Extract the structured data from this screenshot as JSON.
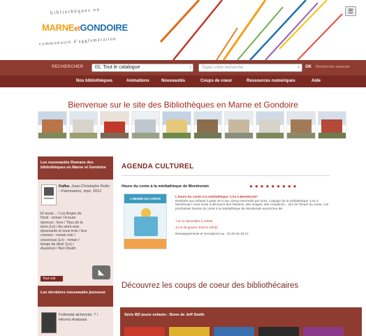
{
  "header": {
    "logo_line1": "bibliothèques en",
    "logo_marne": "MARNE",
    "logo_et": "et",
    "logo_gondoire": "GONDOIRE",
    "logo_line3": "communauté d'agglomération",
    "access_icon": "accessibility-icon"
  },
  "search": {
    "label": "RECHERCHER",
    "catalog_value": "01. Tout le catalogue",
    "input_placeholder": "Tapez votre recherche",
    "ok_label": "OK",
    "advanced_label": "Recherche avancée"
  },
  "nav": {
    "items": [
      "Nos bibliothèques",
      "Animations",
      "Nouveautés",
      "Coups de coeur",
      "Ressources numériques",
      "Aide"
    ]
  },
  "welcome_text": "Bienvenue sur le site des Bibliothèques en Marne et Gondoire",
  "sidebar": {
    "box1_title": "Les nouveautés Romans des bibliothèques en Marne et Gondoire",
    "book_author": "Kafka",
    "book_meta": ": Jean-Christophe Rufin - Flammarion, impr. 2012",
    "book_list": "Et aussi... / Les Anges du Nord : roman / A toute épreuve : livre / Titus de la terre (Le) / Au semi-voie épouvante et sous trois / leur cosmos : roman noir / sous/sous (Le) : roman / temps du désir (Le) / Aussinon / Non Death",
    "voir_label": "Tout voir",
    "box2_title": "Les dernières nouveautés jeunesse",
    "book2_meta": "Fullmetal alchemist. 7 / Hiromu Arakawa"
  },
  "main": {
    "agenda_title": "AGENDA CULTUREL",
    "event_title": "Heure du conte à la médiathèque de Montévrain",
    "event_heading": "L'heure du conte à la médiathèque \"Lire à Montévrain\"",
    "event_desc": "Destinée aux enfants à partir de 5 ans. Deux mercredis par mois. L'équipe de la médiathèque \"Lire à Montévrain\" vous invite à découvrir des histoires, des images, des comptines... lors de l'heure du conte. Les prochaines heures du conte à la médiathèque de Montévrain auront lieu les :",
    "event_date1": "7 et 11 décembre à 10h30",
    "event_date2": "14 et 25 janvier 2015 à 10h30",
    "event_info": "Renseignements et inscriptions au : 01 60 26 03 27",
    "event_img_label": "L'HEURE DU CONTE",
    "coups_title": "Découvrez les coups de coeur des bibliothécaires",
    "carousel_title": "Série BD jeune enfants : Bone de Jeff Smith"
  },
  "colors": {
    "brand": "#8e3b30",
    "nav": "#7a2a22",
    "accent_red": "#c0392b",
    "sidebar_bg": "#f1e4e1"
  }
}
